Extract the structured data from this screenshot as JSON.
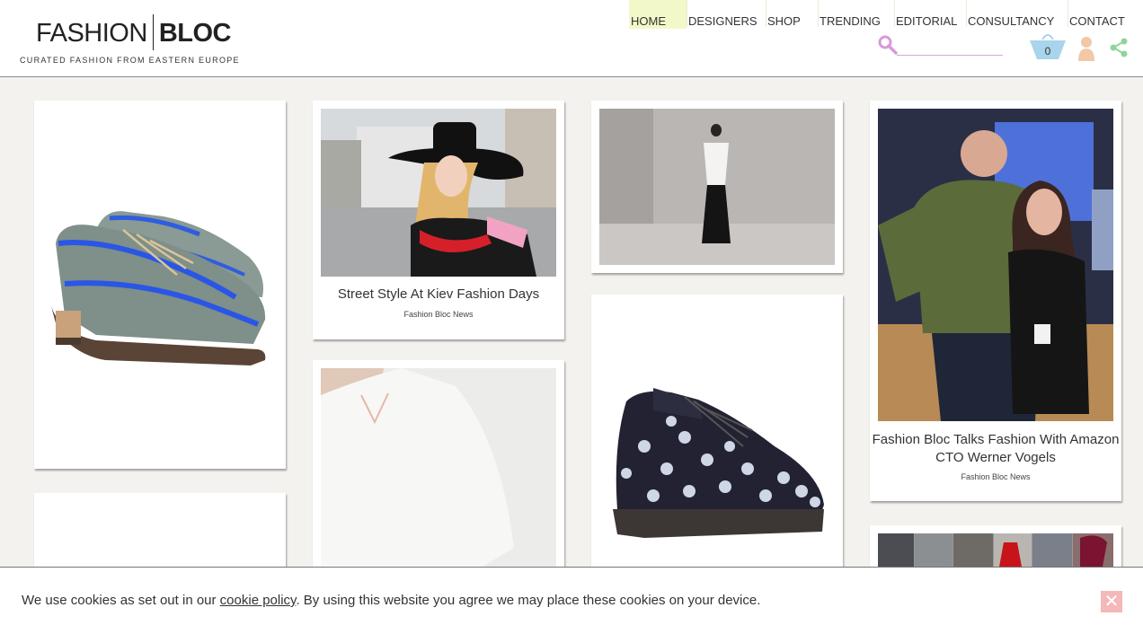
{
  "brand": {
    "name_left": "FASHION",
    "name_right": "BLOC",
    "tagline": "CURATED FASHION FROM EASTERN EUROPE"
  },
  "nav": {
    "items": [
      "HOME",
      "DESIGNERS",
      "SHOP",
      "TRENDING",
      "EDITORIAL",
      "CONSULTANCY",
      "CONTACT"
    ],
    "active": "HOME"
  },
  "tools": {
    "search_placeholder": "",
    "cart_count": "0"
  },
  "cards": [
    {
      "caption": "Street Style At Kiev Fashion Days",
      "sub": "Fashion Bloc News"
    },
    {
      "caption": "Fashion Bloc Talks Fashion With Amazon CTO Werner Vogels",
      "sub": "Fashion Bloc News"
    }
  ],
  "cookie": {
    "prefix": "We use cookies as set out in our ",
    "link": "cookie policy",
    "suffix": ". By using this website you agree we may place these cookies on your device.",
    "close": "✕"
  },
  "colors": {
    "accent_pink": "#d99ad9",
    "cart_blue": "#a8d4ec",
    "user_orange": "#f2c8a6",
    "share_green": "#8fd49a",
    "nav_active": "#f3f8c8"
  }
}
